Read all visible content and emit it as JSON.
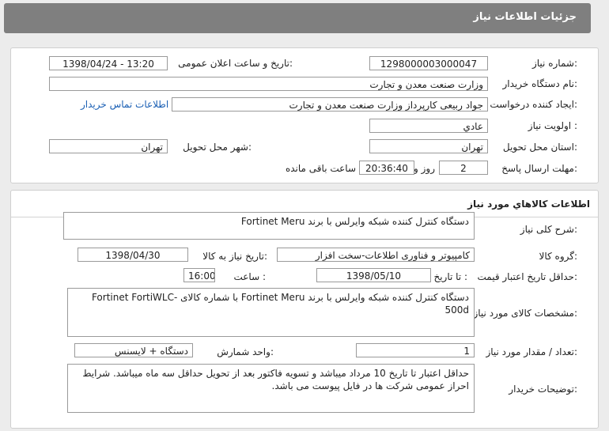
{
  "header": {
    "title": "جزئیات اطلاعات نیاز"
  },
  "info": {
    "need_number_label": "شماره نیاز:",
    "need_number": "1298000003000047",
    "announce_label": "تاریخ و ساعت اعلان عمومی:",
    "announce_value": "1398/04/24 - 13:20",
    "buyer_org_label": "نام دستگاه خریدار:",
    "buyer_org": "وزارت صنعت معدن و تجارت",
    "creator_label": "ایجاد کننده درخواست:",
    "creator": "جواد ربیعی کارپرداز وزارت صنعت معدن و تجارت",
    "contact_link": "اطلاعات تماس خریدار",
    "priority_label": "اولویت نیاز :",
    "priority": "عادي",
    "province_label": "استان محل تحویل:",
    "province": "تهران",
    "city_label": "شهر محل تحویل:",
    "city": "تهران",
    "deadline_label": "مهلت ارسال پاسخ:",
    "days": "2",
    "days_suffix": "روز و",
    "time": "20:36:40",
    "time_suffix": "ساعت باقی مانده"
  },
  "goods": {
    "section_title": "اطلاعات كالاهاي مورد نیاز",
    "general_desc_label": "شرح کلی نیاز:",
    "general_desc": "دستگاه کنترل کننده شبکه وایرلس با برند Fortinet Meru",
    "group_label": "گروه کالا:",
    "group": "کامپیوتر و فناوری اطلاعات-سخت افزار",
    "need_date_label": "تاریخ نیاز به کالا:",
    "need_date": "1398/04/30",
    "validity_label": "حداقل تاریخ اعتبار قیمت:",
    "until_label": "تا تاریخ :",
    "validity_date": "1398/05/10",
    "hour_label": "ساعت :",
    "validity_hour": "16:00",
    "spec_label": "مشخصات کالای مورد نیاز:",
    "spec": "دستگاه کنترل کننده شبکه وایرلس با برند Fortinet Meru  با شماره کالای Fortinet FortiWLC-500d",
    "qty_label": "تعداد / مقدار مورد نیاز:",
    "qty": "1",
    "unit_label": "واحد شمارش:",
    "unit": "دستگاه + لایسنس",
    "notes_label": "توضیحات خریدار:",
    "notes": "حداقل اعتبار تا تاریخ 10 مرداد میباشد و تسویه فاکتور بعد از تحویل حداقل سه ماه میباشد. شرایط احراز عمومی شرکت ها در فایل پیوست می باشد."
  }
}
